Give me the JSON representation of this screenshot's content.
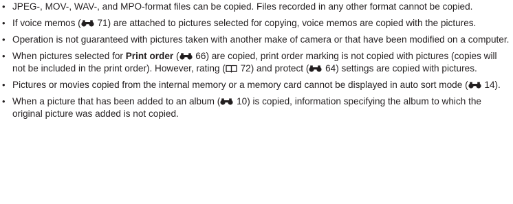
{
  "notes": [
    {
      "parts": [
        {
          "t": "text",
          "v": "JPEG-, MOV-, WAV-, and MPO-format files can be copied. Files recorded in any other format cannot be copied."
        }
      ]
    },
    {
      "parts": [
        {
          "t": "text",
          "v": "If voice memos ("
        },
        {
          "t": "ref",
          "icon": "binoculars-reference-icon",
          "v": " 71"
        },
        {
          "t": "text",
          "v": ") are attached to pictures selected for copying, voice memos are copied with the pictures."
        }
      ]
    },
    {
      "parts": [
        {
          "t": "text",
          "v": "Operation is not guaranteed with pictures taken with another make of camera or that have been modified on a computer."
        }
      ]
    },
    {
      "parts": [
        {
          "t": "text",
          "v": "When pictures selected for "
        },
        {
          "t": "bold",
          "v": "Print order"
        },
        {
          "t": "text",
          "v": " ("
        },
        {
          "t": "ref",
          "icon": "binoculars-reference-icon",
          "v": " 66"
        },
        {
          "t": "text",
          "v": ") are copied, print order marking is not copied with pictures (copies will not be included in the print order). However, rating ("
        },
        {
          "t": "ref",
          "icon": "book-reference-icon",
          "v": " 72"
        },
        {
          "t": "text",
          "v": ") and protect ("
        },
        {
          "t": "ref",
          "icon": "binoculars-reference-icon",
          "v": " 64"
        },
        {
          "t": "text",
          "v": ") settings are copied with pictures."
        }
      ]
    },
    {
      "parts": [
        {
          "t": "text",
          "v": "Pictures or movies copied from the internal memory or a memory card cannot be displayed in auto sort mode ("
        },
        {
          "t": "ref",
          "icon": "binoculars-reference-icon",
          "v": " 14"
        },
        {
          "t": "text",
          "v": ")."
        }
      ]
    },
    {
      "parts": [
        {
          "t": "text",
          "v": "When a picture that has been added to an album ("
        },
        {
          "t": "ref",
          "icon": "binoculars-reference-icon",
          "v": " 10"
        },
        {
          "t": "text",
          "v": ") is copied, information specifying the album to which the original picture was added is not copied."
        }
      ]
    }
  ]
}
